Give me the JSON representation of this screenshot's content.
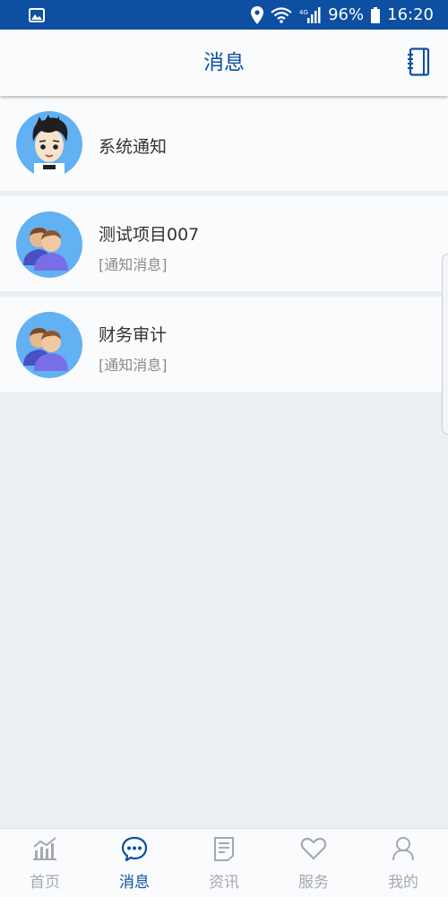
{
  "status_bar": {
    "battery": "96%",
    "time": "16:20",
    "network": "4G"
  },
  "header": {
    "title": "消息"
  },
  "messages": [
    {
      "name": "系统通知",
      "subtitle": "",
      "avatar": "cartoon-boy-avatar"
    },
    {
      "name": "测试项目007",
      "subtitle": "[通知消息]",
      "avatar": "group-avatar"
    },
    {
      "name": "财务审计",
      "subtitle": "[通知消息]",
      "avatar": "group-avatar"
    }
  ],
  "tabs": [
    {
      "label": "首页",
      "icon": "chart-icon",
      "active": false
    },
    {
      "label": "消息",
      "icon": "chat-icon",
      "active": true
    },
    {
      "label": "资讯",
      "icon": "document-icon",
      "active": false
    },
    {
      "label": "服务",
      "icon": "heart-icon",
      "active": false
    },
    {
      "label": "我的",
      "icon": "user-icon",
      "active": false
    }
  ],
  "colors": {
    "primary": "#0d4fa1",
    "avatar_bg": "#62b1f2",
    "inactive": "#a5a9ad"
  }
}
